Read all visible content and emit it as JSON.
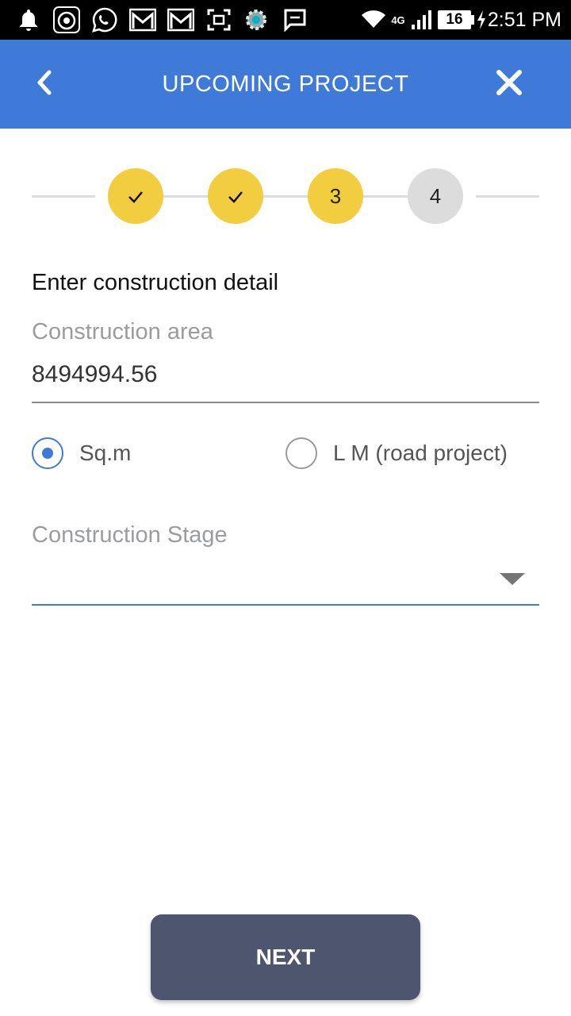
{
  "status_bar": {
    "time": "2:51 PM",
    "battery_level": "16",
    "network_type": "4G",
    "icons": [
      "notification-bell-icon",
      "app-badge-icon",
      "whatsapp-icon",
      "gmail-icon",
      "gmail-icon",
      "screenshot-icon",
      "settings-gear-icon",
      "message-icon",
      "wifi-icon",
      "signal-icon",
      "battery-icon",
      "charging-icon"
    ]
  },
  "app_bar": {
    "title": "UPCOMING PROJECT",
    "back_icon": "chevron-left-icon",
    "close_icon": "close-icon",
    "color": "#3f7ad9"
  },
  "stepper": {
    "steps": [
      {
        "label": "✓",
        "state": "done"
      },
      {
        "label": "✓",
        "state": "done"
      },
      {
        "label": "3",
        "state": "active"
      },
      {
        "label": "4",
        "state": "todo"
      }
    ],
    "active_color": "#f2cd3f",
    "inactive_color": "#dcdcdc"
  },
  "form": {
    "section_title": "Enter construction detail",
    "construction_area": {
      "label": "Construction area",
      "value": "8494994.56"
    },
    "unit_options": [
      {
        "label": "Sq.m",
        "checked": true
      },
      {
        "label": "L M (road project)",
        "checked": false
      }
    ],
    "construction_stage": {
      "label": "Construction Stage",
      "value": ""
    }
  },
  "next_button": {
    "label": "NEXT",
    "color": "#4e556e"
  }
}
